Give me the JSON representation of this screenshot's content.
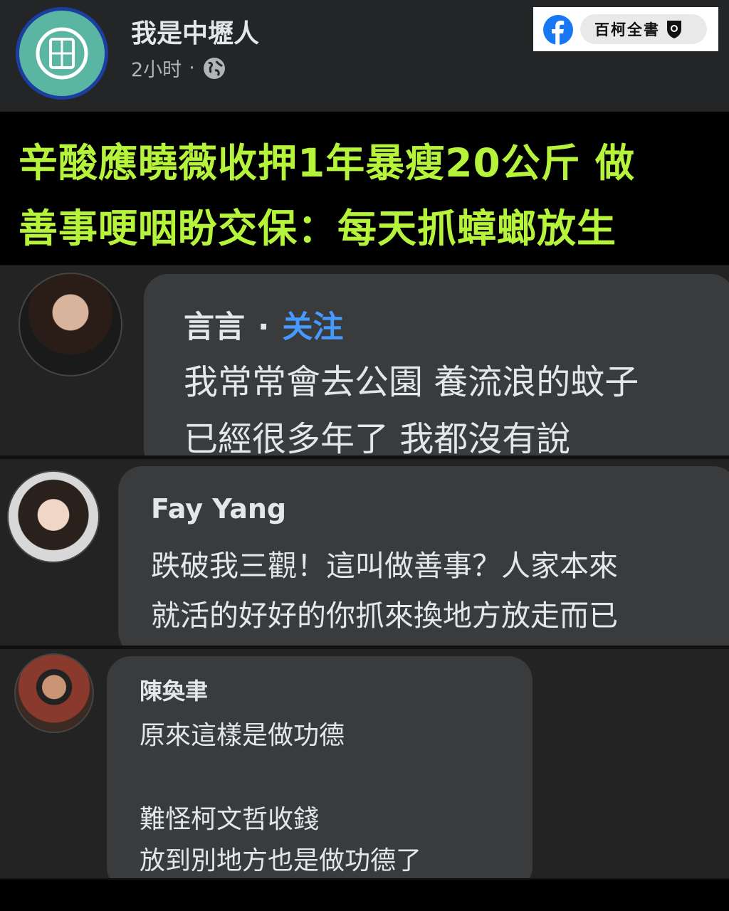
{
  "post": {
    "page_name": "我是中壢人",
    "time": "2小时",
    "separator": "·",
    "privacy_icon": "globe-icon"
  },
  "badge": {
    "icon": "facebook-icon",
    "text": "百柯全書",
    "emblem": "shield-icon"
  },
  "headline": {
    "line1": "辛酸應曉薇收押1年暴瘦20公斤 做",
    "line2": "善事哽咽盼交保：每天抓蟑螂放生",
    "color": "#b6f33b"
  },
  "comments": [
    {
      "author": "言言",
      "separator": "·",
      "follow_label": "关注",
      "lines": [
        "我常常會去公園 養流浪的蚊子",
        "已經很多年了 我都沒有說"
      ]
    },
    {
      "author": "Fay Yang",
      "lines": [
        "跌破我三觀！這叫做善事？人家本來",
        "就活的好好的你抓來換地方放走而已"
      ]
    },
    {
      "author": "陳奐聿",
      "lines": [
        "原來這樣是做功德",
        "",
        "難怪柯文哲收錢",
        "放到別地方也是做功德了"
      ]
    }
  ]
}
